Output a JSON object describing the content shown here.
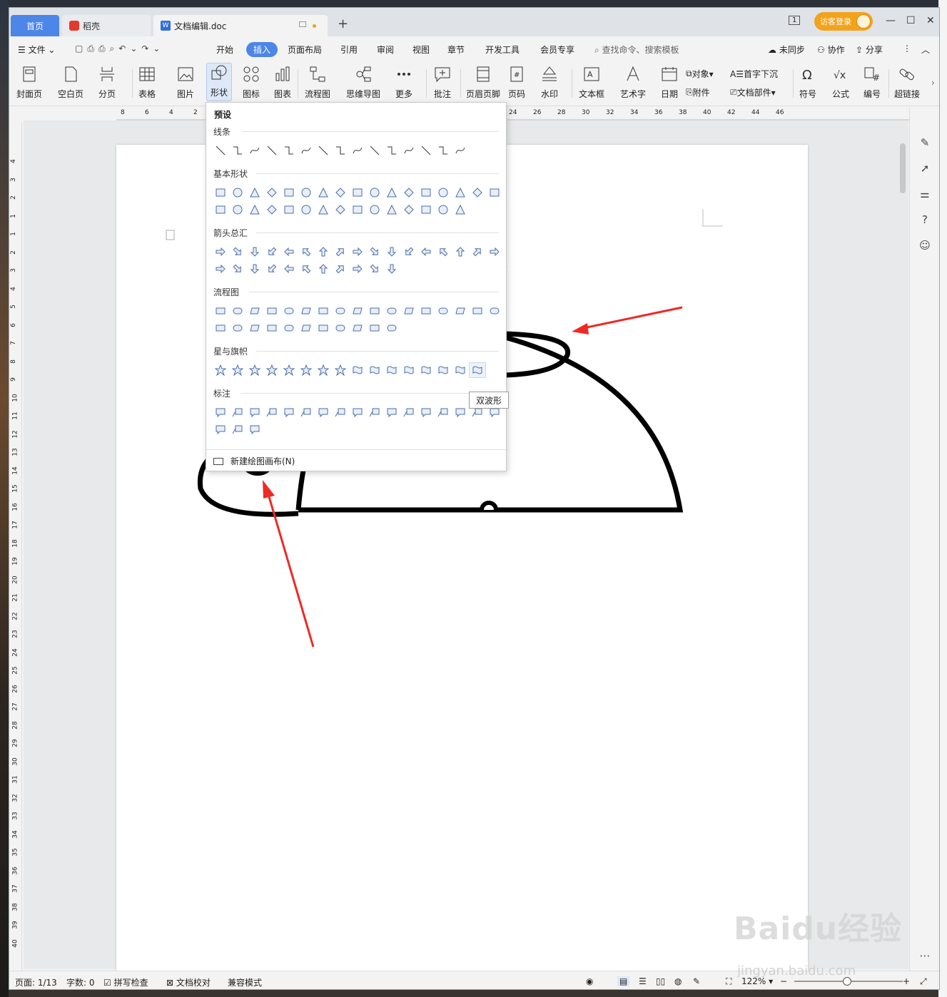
{
  "tabs": {
    "home": "首页",
    "daoke": "稻壳",
    "doc": "文档编辑.doc",
    "page_badge": "1",
    "login": "访客登录"
  },
  "menu": {
    "file": "文件",
    "items": [
      "开始",
      "插入",
      "页面布局",
      "引用",
      "审阅",
      "视图",
      "章节",
      "开发工具",
      "会员专享"
    ],
    "active": "插入",
    "search_placeholder": "查找命令、搜索模板",
    "sync": "未同步",
    "collab": "协作",
    "share": "分享"
  },
  "ribbon": {
    "cover": "封面页",
    "blank": "空白页",
    "pagebreak": "分页",
    "table": "表格",
    "picture": "图片",
    "shape": "形状",
    "icon": "图标",
    "chart": "图表",
    "flowchart": "流程图",
    "mindmap": "思维导图",
    "more": "更多",
    "comment": "批注",
    "header_footer": "页眉页脚",
    "page_number": "页码",
    "watermark": "水印",
    "textbox": "文本框",
    "wordart": "艺术字",
    "date": "日期",
    "object": "对象",
    "attachment": "附件",
    "dropcap": "首字下沉",
    "doc_parts": "文档部件",
    "symbol": "符号",
    "formula": "公式",
    "numbering": "编号",
    "hyperlink": "超链接"
  },
  "ruler_h": [
    "8",
    "6",
    "4",
    "2",
    "24",
    "26",
    "28",
    "30",
    "32",
    "34",
    "36",
    "38",
    "40",
    "42",
    "44",
    "46"
  ],
  "ruler_v": [
    "4",
    "3",
    "2",
    "1",
    "1",
    "2",
    "3",
    "4",
    "5",
    "6",
    "7",
    "8",
    "9",
    "10",
    "11",
    "12",
    "13",
    "14",
    "15",
    "16",
    "17",
    "18",
    "19",
    "20",
    "21",
    "22",
    "23",
    "24",
    "25",
    "26",
    "27",
    "28",
    "29",
    "30",
    "31",
    "32",
    "33",
    "34",
    "35",
    "36",
    "37",
    "38",
    "39",
    "40"
  ],
  "dropdown": {
    "title": "预设",
    "categories": [
      "线条",
      "基本形状",
      "箭头总汇",
      "流程图",
      "星与旗帜",
      "标注"
    ],
    "new_canvas": "新建绘图画布(N)",
    "tooltip": "双波形"
  },
  "status": {
    "page": "页面: 1/13",
    "words": "字数: 0",
    "spellcheck": "拼写检查",
    "proofread": "文档校对",
    "compat": "兼容模式",
    "zoom": "122%"
  },
  "watermark": {
    "brand": "Baidu经验",
    "url": "jingyan.baidu.com"
  },
  "colors": {
    "accent": "#4b86e8",
    "login": "#f2a31d",
    "arrow": "#ee2a24"
  }
}
